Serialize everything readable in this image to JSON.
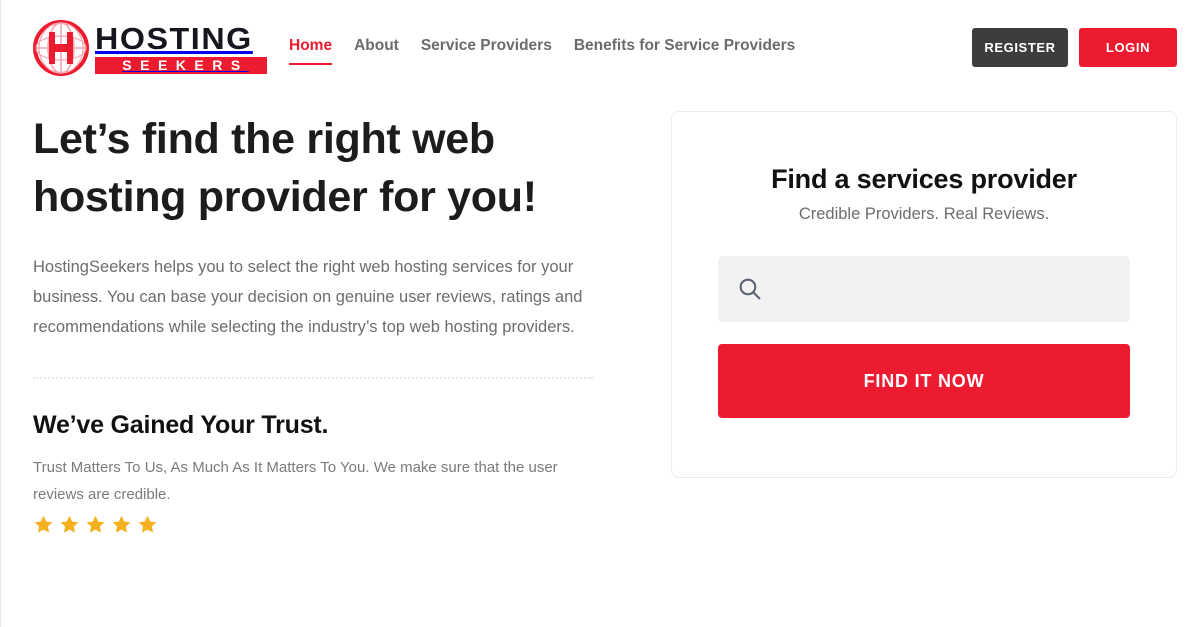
{
  "brand": {
    "logo_primary_text": "HOSTING",
    "logo_secondary_text": "SEEKERS",
    "accent_red": "#ED1B2F",
    "dark_button": "#3D3D3D",
    "star_gold": "#F5B01F"
  },
  "nav": {
    "items": [
      {
        "label": "Home",
        "active": true
      },
      {
        "label": "About",
        "active": false
      },
      {
        "label": "Service Providers",
        "active": false
      },
      {
        "label": "Benefits for Service Providers",
        "active": false
      }
    ]
  },
  "header_actions": {
    "register_label": "REGISTER",
    "login_label": "LOGIN"
  },
  "hero": {
    "heading": "Let’s find the right web hosting provider for you!",
    "paragraph": "HostingSeekers helps you to select the right web hosting services for your business. You can base your decision on genuine user reviews, ratings and recommendations while selecting the industry’s top web hosting providers."
  },
  "trust": {
    "heading": "We’ve Gained Your Trust.",
    "paragraph": "Trust Matters To Us, As Much As It Matters To You. We make sure that the user reviews are credible.",
    "stars_filled": 5,
    "stars_total": 5
  },
  "finder": {
    "title": "Find a services provider",
    "subtitle": "Credible Providers. Real Reviews.",
    "search_value": "",
    "search_placeholder": "",
    "search_icon": "search-icon",
    "submit_label": "FIND IT NOW"
  }
}
